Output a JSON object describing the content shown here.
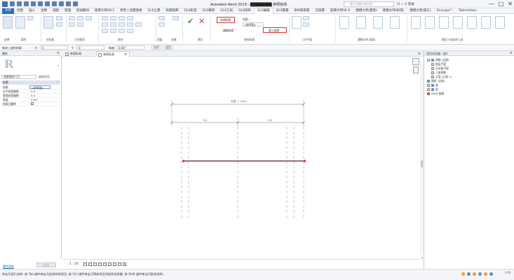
{
  "app": {
    "title": "Autodesk Revit 2019 - ████████ 参照标高",
    "search_placeholder": "键入关键字或短语",
    "right_icons_text": "凸 ☆ 2 登录",
    "window_controls": [
      "—",
      "□",
      "✕"
    ]
  },
  "ribbon_tabs": [
    {
      "label": "文件",
      "kind": "file"
    },
    {
      "label": "创建",
      "kind": "normal"
    },
    {
      "label": "插入",
      "kind": "normal"
    },
    {
      "label": "注释",
      "kind": "normal"
    },
    {
      "label": "视图",
      "kind": "normal"
    },
    {
      "label": "管理",
      "kind": "normal"
    },
    {
      "label": "附加模块",
      "kind": "normal"
    },
    {
      "label": "族库大师V6.2",
      "kind": "normal"
    },
    {
      "label": "修改 | 创建放样",
      "kind": "normal"
    },
    {
      "label": "GLS土建",
      "kind": "normal"
    },
    {
      "label": "构建族库",
      "kind": "normal"
    },
    {
      "label": "GLS机电",
      "kind": "normal"
    },
    {
      "label": "GLS精装",
      "kind": "normal"
    },
    {
      "label": "GLS工具",
      "kind": "normal"
    },
    {
      "label": "GLS场布",
      "kind": "normal"
    },
    {
      "label": "GLS编辑",
      "kind": "active"
    },
    {
      "label": "GLS算量",
      "kind": "normal"
    },
    {
      "label": "BIM族管家",
      "kind": "normal"
    },
    {
      "label": "云族库",
      "kind": "normal"
    },
    {
      "label": "族库大师V6.0",
      "kind": "normal"
    },
    {
      "label": "建模大师(建筑)",
      "kind": "normal"
    },
    {
      "label": "建模大师(机电)",
      "kind": "normal"
    },
    {
      "label": "建模大师(施工)",
      "kind": "normal"
    },
    {
      "label": "Enscape™",
      "kind": "normal"
    },
    {
      "label": "Twinmotion",
      "kind": "normal"
    }
  ],
  "ribbon": {
    "highlight_1": "选择轮廓",
    "highlight_2": "载入轮廓",
    "profile_label": "轮廓:",
    "profile_value": "<按草图>",
    "edit_profile": "编辑轮廓",
    "panels": [
      "选择",
      "属性",
      "剪贴板",
      "几何图形",
      "修改",
      "测量",
      "创建",
      "模式",
      "放样轮廓",
      "工作平面",
      "建模大师(通用)",
      "模型人机族库工具"
    ]
  },
  "optionsbar": {
    "modify_label": "修改 | 放样轮廓",
    "x_label": "X:",
    "x_value": "0",
    "y_label": "Y:",
    "y_value": "0",
    "angle_label": "角度:",
    "angle_value": "0.00°",
    "btn1": "应用",
    "btn2": "返回"
  },
  "properties": {
    "title": "属性",
    "filter": "轮廓载荷 (1)",
    "edit_type": "编辑类型",
    "group": "轮廓",
    "rows": [
      {
        "k": "轮廓",
        "v": "<按草图>"
      },
      {
        "k": "水平轮廓偏移",
        "v": "0.0"
      },
      {
        "k": "垂直轮廓偏移",
        "v": "0.0"
      },
      {
        "k": "角度",
        "v": "0.00°"
      },
      {
        "k": "轮廓已翻转",
        "v": ""
      }
    ],
    "help": "属性帮助",
    "apply": "应用"
  },
  "view_tabs": [
    {
      "label": "参照标高",
      "active": false
    },
    {
      "label": "参照标高",
      "active": true
    }
  ],
  "canvas": {
    "overall_dim": "长度 = 1000",
    "dim_left": "EQ",
    "dim_right": "EQ"
  },
  "view_control": {
    "scale": "1 : 20"
  },
  "project_browser": {
    "title": "项目浏览器 - 族1",
    "items": [
      {
        "label": "视图 (全部)",
        "level": 0,
        "toggle": "−",
        "icon": "view"
      },
      {
        "label": "楼层平面",
        "level": 1,
        "toggle": "+",
        "icon": ""
      },
      {
        "label": "天花板平面",
        "level": 1,
        "toggle": "+",
        "icon": ""
      },
      {
        "label": "三维视图",
        "level": 1,
        "toggle": "+",
        "icon": ""
      },
      {
        "label": "立面 (立面 1)",
        "level": 1,
        "toggle": "+",
        "icon": ""
      },
      {
        "label": "图纸 (全部)",
        "level": 0,
        "toggle": "",
        "icon": "sheet"
      },
      {
        "label": "族",
        "level": 0,
        "toggle": "+",
        "icon": "family"
      },
      {
        "label": "组",
        "level": 0,
        "toggle": "+",
        "icon": "group"
      },
      {
        "label": "Revit 链接",
        "level": 0,
        "toggle": "",
        "icon": "revit"
      }
    ]
  },
  "status": {
    "text": "单击可进行选择; 按 Tab 键并单击可选择其他项目; 按 Ctrl 键并单击可将新项目添加到选择集; 按 Shift 键并单击可取消选择。",
    "filter": "▽:0"
  }
}
